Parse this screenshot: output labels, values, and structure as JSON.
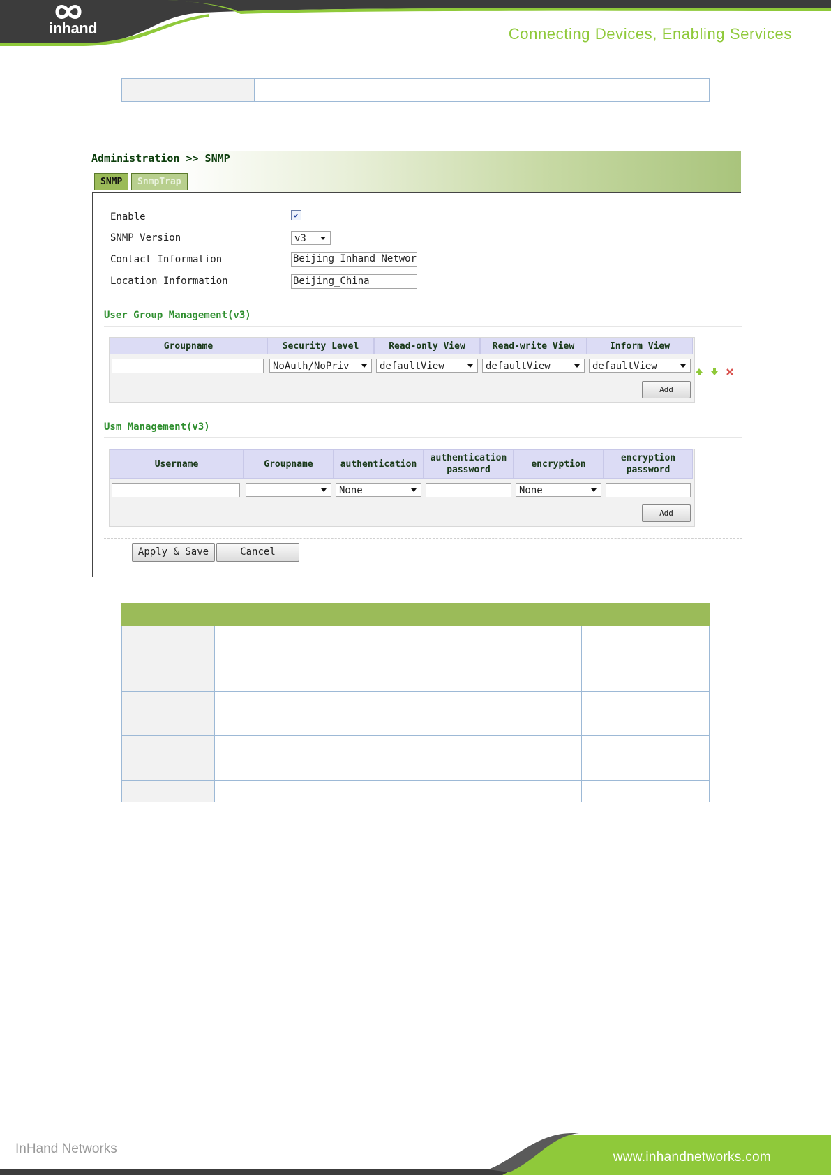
{
  "header": {
    "logo_text": "inhand",
    "slogan": "Connecting Devices, Enabling Services"
  },
  "snmp_page": {
    "breadcrumb": "Administration >> SNMP",
    "tabs": [
      {
        "label": "SNMP",
        "active": true
      },
      {
        "label": "SnmpTrap",
        "active": false
      }
    ],
    "fields": {
      "enable_label": "Enable",
      "enable_checked": true,
      "version_label": "SNMP Version",
      "version_value": "v3",
      "contact_label": "Contact Information",
      "contact_value": "Beijing_Inhand_Networ",
      "location_label": "Location Information",
      "location_value": "Beijing_China"
    },
    "user_group": {
      "title": "User Group Management(v3)",
      "columns": [
        "Groupname",
        "Security Level",
        "Read-only View",
        "Read-write View",
        "Inform View"
      ],
      "row": {
        "groupname": "",
        "security_level": "NoAuth/NoPriv",
        "read_only_view": "defaultView",
        "read_write_view": "defaultView",
        "inform_view": "defaultView"
      },
      "add_label": "Add"
    },
    "usm": {
      "title": "Usm Management(v3)",
      "columns": [
        "Username",
        "Groupname",
        "authentication",
        "authentication password",
        "encryption",
        "encryption password"
      ],
      "row": {
        "username": "",
        "groupname": "",
        "authentication": "None",
        "authentication_password": "",
        "encryption": "None",
        "encryption_password": ""
      },
      "add_label": "Add"
    },
    "actions": {
      "apply_label": "Apply & Save",
      "cancel_label": "Cancel"
    }
  },
  "footer": {
    "company": "InHand Networks",
    "website": "www.inhandnetworks.com"
  },
  "colors": {
    "accent_green": "#9bbb59",
    "slogan_green": "#8fc93a",
    "header_dark": "#3c3c3c"
  }
}
